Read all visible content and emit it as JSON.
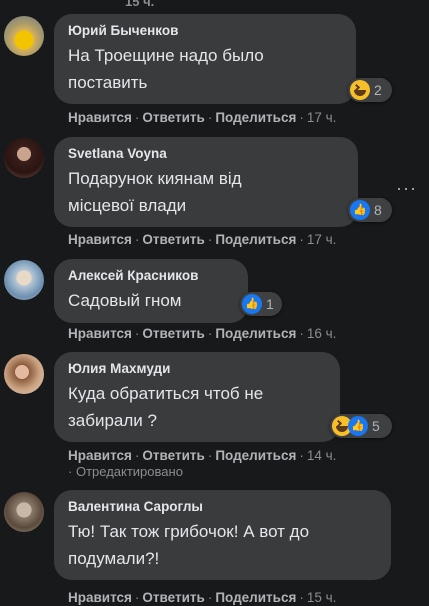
{
  "top_fragment": "15 ч.",
  "action_labels": {
    "like": "Нравится",
    "reply": "Ответить",
    "share": "Поделиться"
  },
  "comments": [
    {
      "author": "Юрий Быченков",
      "text": "На Троещине надо было\nпоставить",
      "reaction_count": "2",
      "reactions": [
        "haha-icon"
      ],
      "time": "17 ч."
    },
    {
      "author": "Svetlana Voyna",
      "text": "Подарунок киянам від\nмісцевої влади",
      "reaction_count": "8",
      "reactions": [
        "like-icon"
      ],
      "time": "17 ч."
    },
    {
      "author": "Алексей Красников",
      "text": "Садовый гном",
      "reaction_count": "1",
      "reactions": [
        "like-icon"
      ],
      "time": "16 ч."
    },
    {
      "author": "Юлия Махмуди",
      "text": "Куда обратиться чтоб не\nзабирали ?",
      "reaction_count": "5",
      "reactions": [
        "haha-icon",
        "like-icon"
      ],
      "time": "14 ч.",
      "edited": "Отредактировано"
    },
    {
      "author": "Валентина Сароглы",
      "text": "Тю! Так тож грибочок! А вот до\nподумали?!",
      "time": "15 ч."
    }
  ],
  "more_menu": "···",
  "colors": {
    "background": "#18191a",
    "bubble": "#3a3b3c",
    "like": "#1877f2",
    "haha": "#f7c02a"
  }
}
